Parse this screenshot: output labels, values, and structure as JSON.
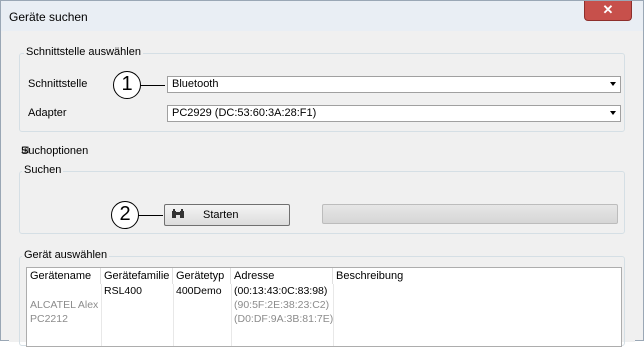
{
  "window": {
    "title": "Geräte suchen",
    "close_glyph": "✕"
  },
  "interface_group": {
    "title": "Schnittstelle auswählen",
    "interface_label": "Schnittstelle",
    "interface_value": "Bluetooth",
    "adapter_label": "Adapter",
    "adapter_value": "PC2929 (DC:53:60:3A:28:F1)"
  },
  "callouts": {
    "one": "1",
    "two": "2"
  },
  "search_options": {
    "expander_glyph": "⊞",
    "label": "Suchoptionen"
  },
  "search_group": {
    "title": "Suchen",
    "start_button": "Starten",
    "start_icon": "binoculars-icon",
    "progress": 0
  },
  "device_group": {
    "title": "Gerät auswählen",
    "columns": [
      "Gerätename",
      "Gerätefamilie",
      "Gerätetyp",
      "Adresse",
      "Beschreibung"
    ],
    "rows": [
      {
        "name": "",
        "family": "RSL400",
        "type": "400Demo",
        "address": "(00:13:43:0C:83:98)",
        "description": "",
        "greyed": false
      },
      {
        "name": "ALCATEL Alex",
        "family": "",
        "type": "",
        "address": "(90:5F:2E:38:23:C2)",
        "description": "",
        "greyed": true
      },
      {
        "name": "PC2212",
        "family": "",
        "type": "",
        "address": "(D0:DF:9A:3B:81:7E)",
        "description": "",
        "greyed": true
      }
    ]
  },
  "colors": {
    "close_button": "#c7504b",
    "greyed_text": "#8c8c8c"
  }
}
